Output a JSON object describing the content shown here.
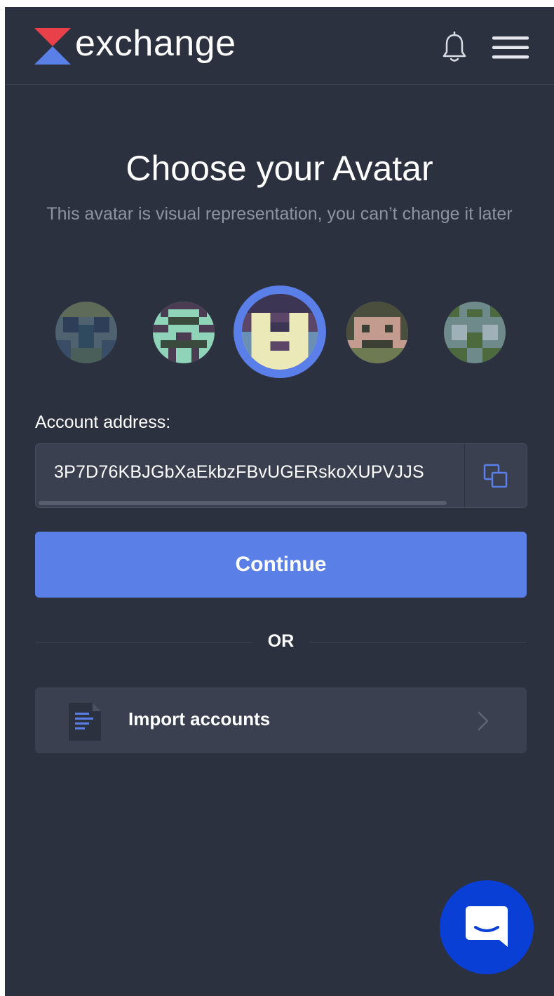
{
  "header": {
    "brand": "exchange",
    "logo_icon": "exchange-logo-icon",
    "notification_icon": "bell-icon",
    "menu_icon": "hamburger-menu-icon",
    "colors": {
      "logo_top": "#e9404a",
      "logo_bottom": "#5a80e8",
      "background": "#2c313f"
    }
  },
  "page": {
    "title": "Choose your Avatar",
    "subtitle": "This avatar is visual representation, you can’t change it later"
  },
  "avatars": {
    "count": 5,
    "selected_index": 2,
    "selection_ring_color": "#5b7fe8"
  },
  "account": {
    "label": "Account address:",
    "address": "3P7D76KBJGbXaEkbzFBvUGERskoXUPVJJS",
    "copy_icon": "copy-icon"
  },
  "actions": {
    "continue_label": "Continue",
    "or_label": "OR",
    "import_label": "Import accounts",
    "import_icon": "document-icon",
    "import_chevron": "chevron-right-icon",
    "accent_color": "#5a80e8"
  },
  "chat": {
    "icon": "chat-bubble-icon",
    "color": "#0a3fd6"
  }
}
